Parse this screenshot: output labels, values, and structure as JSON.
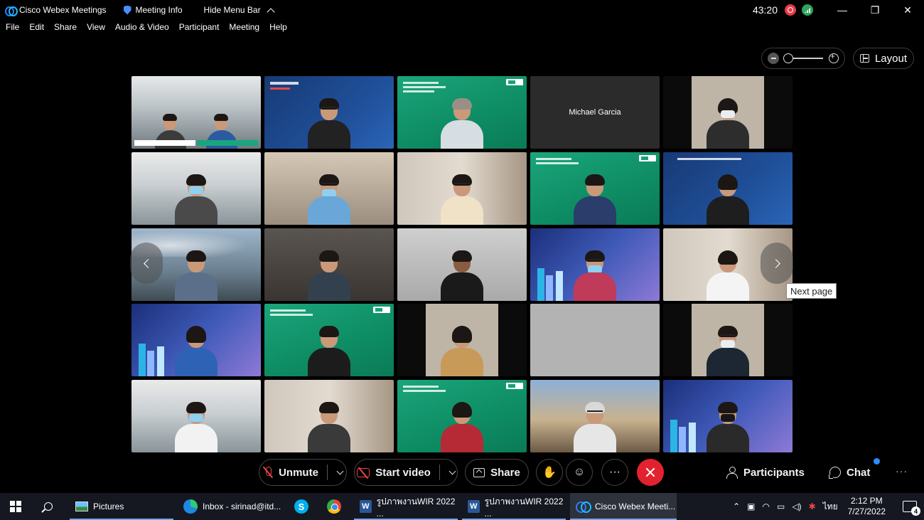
{
  "titlebar": {
    "app_name": "Cisco Webex Meetings",
    "meeting_info": "Meeting Info",
    "hide_menu": "Hide Menu Bar",
    "timer": "43:20",
    "minimize": "—",
    "restore": "❐",
    "close": "✕"
  },
  "menu": [
    "File",
    "Edit",
    "Share",
    "View",
    "Audio & Video",
    "Participant",
    "Meeting",
    "Help"
  ],
  "layout_button": "Layout",
  "tiles": [
    {
      "name": "",
      "bg": "office"
    },
    {
      "name": "",
      "bg": "blue"
    },
    {
      "name": "",
      "bg": "green"
    },
    {
      "name": "Michael Garcia",
      "bg": "dark"
    },
    {
      "name": "",
      "bg": "pillar"
    },
    {
      "name": "",
      "bg": "lab"
    },
    {
      "name": "",
      "bg": "room"
    },
    {
      "name": "",
      "bg": "wall"
    },
    {
      "name": "",
      "bg": "green"
    },
    {
      "name": "",
      "bg": "blue"
    },
    {
      "name": "",
      "bg": "sky"
    },
    {
      "name": "",
      "bg": "dim"
    },
    {
      "name": "",
      "bg": "gray2"
    },
    {
      "name": "",
      "bg": "purple"
    },
    {
      "name": "",
      "bg": "wall"
    },
    {
      "name": "",
      "bg": "purple"
    },
    {
      "name": "",
      "bg": "green"
    },
    {
      "name": "",
      "bg": "pillar"
    },
    {
      "name": "",
      "bg": "grey"
    },
    {
      "name": "",
      "bg": "pillar"
    },
    {
      "name": "",
      "bg": "lab"
    },
    {
      "name": "",
      "bg": "wall"
    },
    {
      "name": "",
      "bg": "green"
    },
    {
      "name": "",
      "bg": "window"
    },
    {
      "name": "",
      "bg": "purple"
    }
  ],
  "tooltip": "Next page",
  "controls": {
    "unmute": "Unmute",
    "start_video": "Start video",
    "share": "Share",
    "participants": "Participants",
    "chat": "Chat",
    "more": "···",
    "reactions": "☺",
    "raise_hand": "✋"
  },
  "taskbar": {
    "items": [
      {
        "label": "Pictures"
      },
      {
        "label": "Inbox - sirinad@itd..."
      },
      {
        "label": "รูปภาพงานWIR 2022 ..."
      },
      {
        "label": "รูปภาพงานWIR 2022 ..."
      },
      {
        "label": "Cisco Webex Meeti..."
      }
    ],
    "lang": "ไทย",
    "time": "2:12 PM",
    "date": "7/27/2022",
    "notif_count": "4",
    "tray_up": "⌃"
  }
}
